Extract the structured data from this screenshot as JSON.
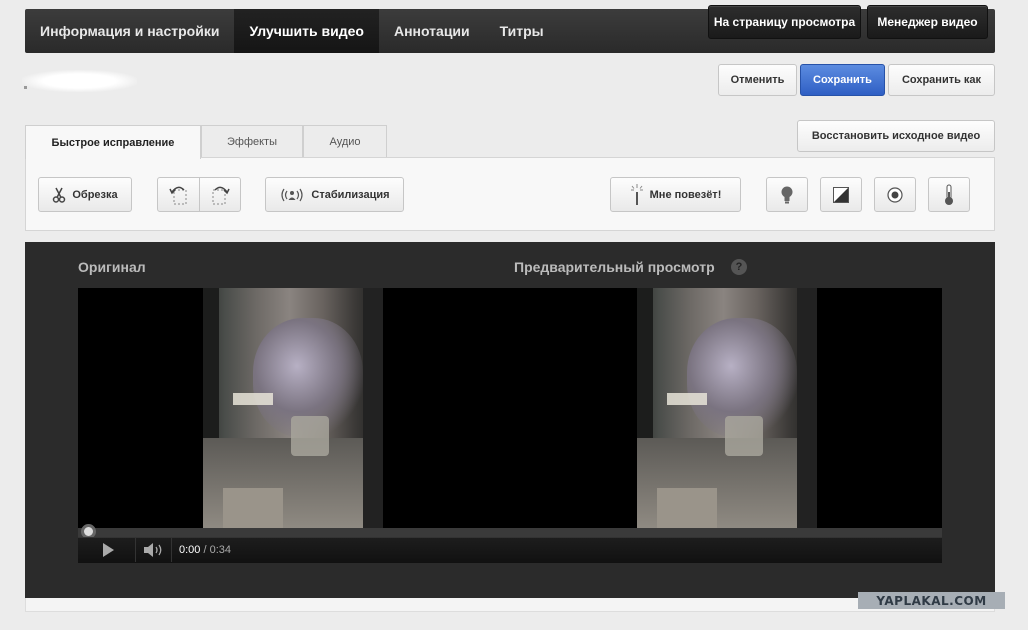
{
  "topnav": {
    "tabs": [
      {
        "label": "Информация и настройки"
      },
      {
        "label": "Улучшить видео",
        "active": true
      },
      {
        "label": "Аннотации"
      },
      {
        "label": "Титры"
      }
    ],
    "view_page_label": "На страницу просмотра",
    "video_manager_label": "Менеджер видео"
  },
  "actions": {
    "cancel_label": "Отменить",
    "save_label": "Сохранить",
    "save_as_label": "Сохранить как",
    "restore_label": "Восстановить исходное видео"
  },
  "subtabs": [
    {
      "label": "Быстрое исправление",
      "active": true
    },
    {
      "label": "Эффекты"
    },
    {
      "label": "Аудио"
    }
  ],
  "tools": {
    "trim_label": "Обрезка",
    "stabilize_label": "Стабилизация",
    "lucky_label": "Мне повезёт!",
    "icons": [
      "scissors-icon",
      "rotate-left-icon",
      "rotate-right-icon",
      "stabilize-icon",
      "magic-wand-icon",
      "lightbulb-icon",
      "contrast-icon",
      "saturation-icon",
      "thermometer-icon"
    ]
  },
  "preview": {
    "original_label": "Оригинал",
    "preview_label": "Предварительный просмотр",
    "help_glyph": "?"
  },
  "player": {
    "current_time": "0:00",
    "separator": " / ",
    "duration": "0:34",
    "progress": 0
  },
  "watermark": "YAPLAKAL.COM",
  "colors": {
    "nav_bg": "#333333",
    "primary": "#3b6fd4",
    "video_bg": "#2b2b2b"
  }
}
